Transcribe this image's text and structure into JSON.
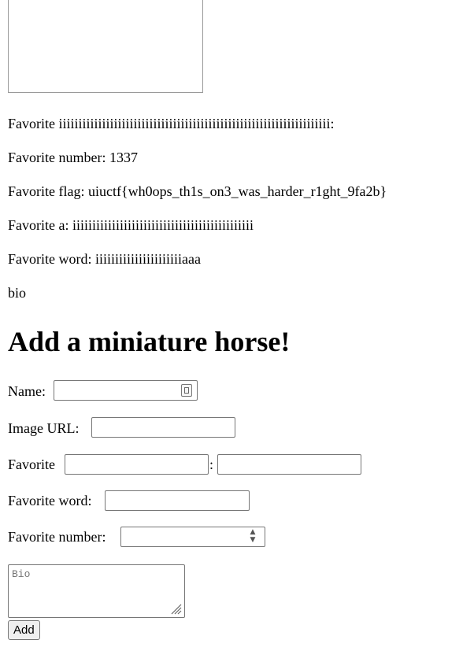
{
  "horse": {
    "favorite_custom_line": "Favorite iiiiiiiiiiiiiiiiiiiiiiiiiiiiiiiiiiiiiiiiiiiiiiiiiiiiiiiiiiiiiiiiiiiii:",
    "favorite_number_line": "Favorite number: 1337",
    "favorite_flag_line": "Favorite flag: uiuctf{wh0ops_th1s_on3_was_harder_r1ght_9fa2b}",
    "favorite_a_line": "Favorite a: iiiiiiiiiiiiiiiiiiiiiiiiiiiiiiiiiiiiiiiiiiiiii",
    "favorite_word_line": "Favorite word: iiiiiiiiiiiiiiiiiiiiiiaaa",
    "bio": "bio"
  },
  "form": {
    "heading": "Add a miniature horse!",
    "name_label": "Name:",
    "image_url_label": "Image URL:",
    "favorite_label": "Favorite",
    "colon": ":",
    "favorite_word_label": "Favorite word:",
    "favorite_number_label": "Favorite number:",
    "bio_placeholder": "Bio",
    "add_button": "Add"
  }
}
